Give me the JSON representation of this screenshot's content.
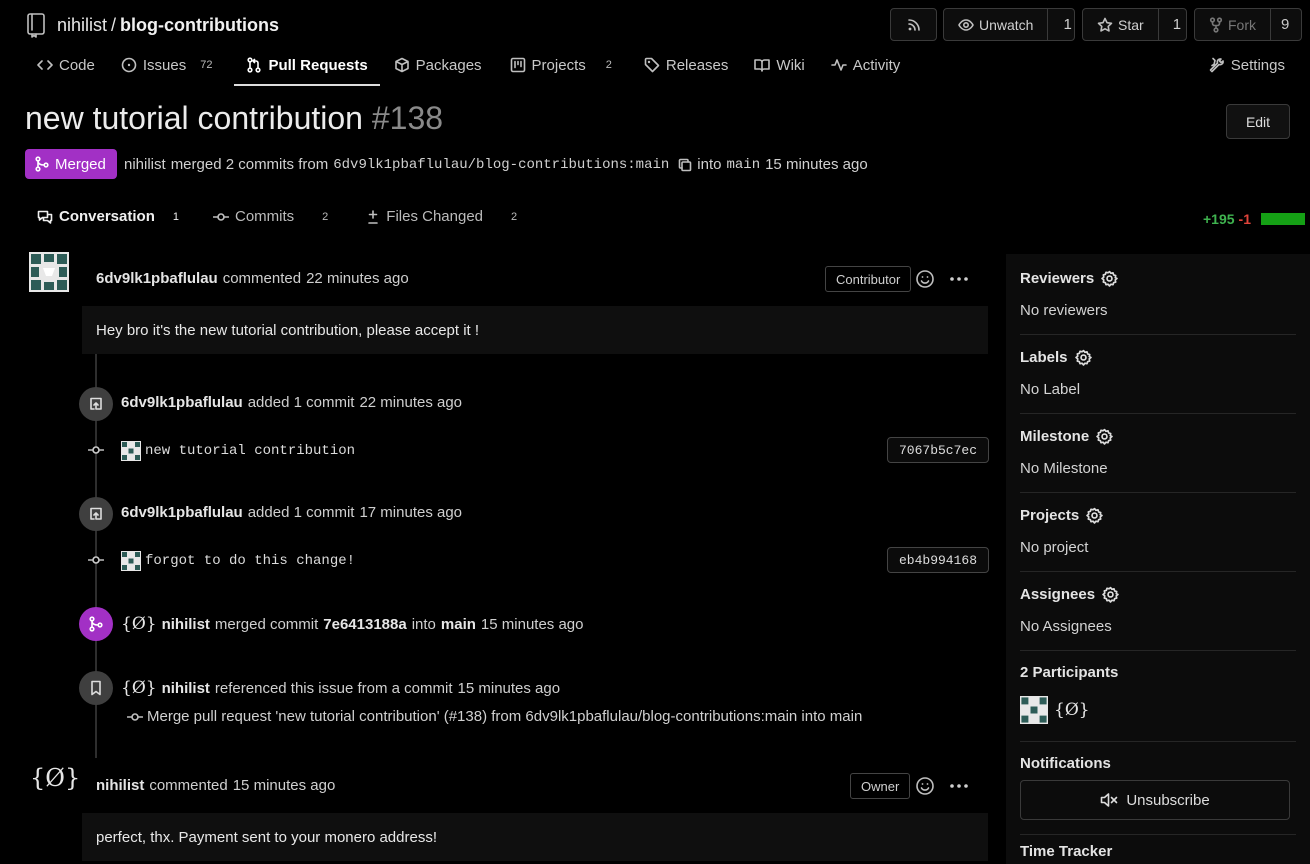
{
  "repo": {
    "owner": "nihilist",
    "separator": "/",
    "name": "blog-contributions"
  },
  "header_buttons": {
    "unwatch_label": "Unwatch",
    "unwatch_count": "1",
    "star_label": "Star",
    "star_count": "1",
    "fork_label": "Fork",
    "fork_count": "9"
  },
  "tabs": [
    {
      "label": "Code",
      "badge": ""
    },
    {
      "label": "Issues",
      "badge": "72"
    },
    {
      "label": "Pull Requests",
      "badge": ""
    },
    {
      "label": "Packages",
      "badge": ""
    },
    {
      "label": "Projects",
      "badge": "2"
    },
    {
      "label": "Releases",
      "badge": ""
    },
    {
      "label": "Wiki",
      "badge": ""
    },
    {
      "label": "Activity",
      "badge": ""
    }
  ],
  "settings_label": "Settings",
  "pr": {
    "title": "new tutorial contribution",
    "number": "#138",
    "edit_label": "Edit",
    "status": "Merged",
    "meta_user": "nihilist",
    "meta_action": "merged 2 commits from",
    "meta_source": "6dv9lk1pbaflulau/blog-contributions:main",
    "meta_into": "into",
    "meta_target": "main",
    "meta_time": "15 minutes ago"
  },
  "subtabs": [
    {
      "label": "Conversation",
      "badge": "1"
    },
    {
      "label": "Commits",
      "badge": "2"
    },
    {
      "label": "Files Changed",
      "badge": "2"
    }
  ],
  "diffstat": {
    "additions": "+195",
    "deletions": "-1"
  },
  "timeline": {
    "comment1": {
      "author": "6dv9lk1pbaflulau",
      "action": "commented",
      "time": "22 minutes ago",
      "role": "Contributor",
      "body": "Hey bro it's the new tutorial contribution, please accept it !"
    },
    "event1": {
      "author": "6dv9lk1pbaflulau",
      "action": "added 1 commit",
      "time": "22 minutes ago"
    },
    "commit1": {
      "message": "new tutorial contribution",
      "sha": "7067b5c7ec"
    },
    "event2": {
      "author": "6dv9lk1pbaflulau",
      "action": "added 1 commit",
      "time": "17 minutes ago"
    },
    "commit2": {
      "message": "forgot to do this change!",
      "sha": "eb4b994168"
    },
    "merge_event": {
      "logo": "{Ø}",
      "author": "nihilist",
      "action": "merged commit",
      "commit": "7e6413188a",
      "into": "into",
      "branch": "main",
      "time": "15 minutes ago"
    },
    "ref_event": {
      "logo": "{Ø}",
      "author": "nihilist",
      "action": "referenced this issue from a commit",
      "time": "15 minutes ago",
      "commit_message": "Merge pull request 'new tutorial contribution' (#138) from 6dv9lk1pbaflulau/blog-contributions:main into main"
    },
    "comment2": {
      "logo": "{Ø}",
      "author": "nihilist",
      "action": "commented",
      "time": "15 minutes ago",
      "role": "Owner",
      "body": "perfect, thx. Payment sent to your monero address!"
    }
  },
  "sidebar": {
    "reviewers": {
      "title": "Reviewers",
      "value": "No reviewers"
    },
    "labels": {
      "title": "Labels",
      "value": "No Label"
    },
    "milestone": {
      "title": "Milestone",
      "value": "No Milestone"
    },
    "projects": {
      "title": "Projects",
      "value": "No project"
    },
    "assignees": {
      "title": "Assignees",
      "value": "No Assignees"
    },
    "participants": {
      "title": "2 Participants",
      "logo": "{Ø}"
    },
    "notifications": {
      "title": "Notifications",
      "button": "Unsubscribe"
    },
    "time_tracker": {
      "title": "Time Tracker"
    }
  },
  "colors": {
    "merged": "#a230c5",
    "additions": "#3fb34f",
    "deletions": "#e0433a",
    "background": "#000000"
  },
  "icons": [
    "repo-icon",
    "rss-icon",
    "eye-icon",
    "star-icon",
    "fork-icon",
    "code-icon",
    "issue-icon",
    "pull-request-icon",
    "package-icon",
    "project-icon",
    "tag-icon",
    "book-icon",
    "pulse-icon",
    "tools-icon",
    "merge-icon",
    "copy-icon",
    "comment-icon",
    "commit-icon",
    "diff-icon",
    "emoji-icon",
    "kebab-icon",
    "push-icon",
    "bookmark-icon",
    "gear-icon",
    "mute-icon"
  ]
}
